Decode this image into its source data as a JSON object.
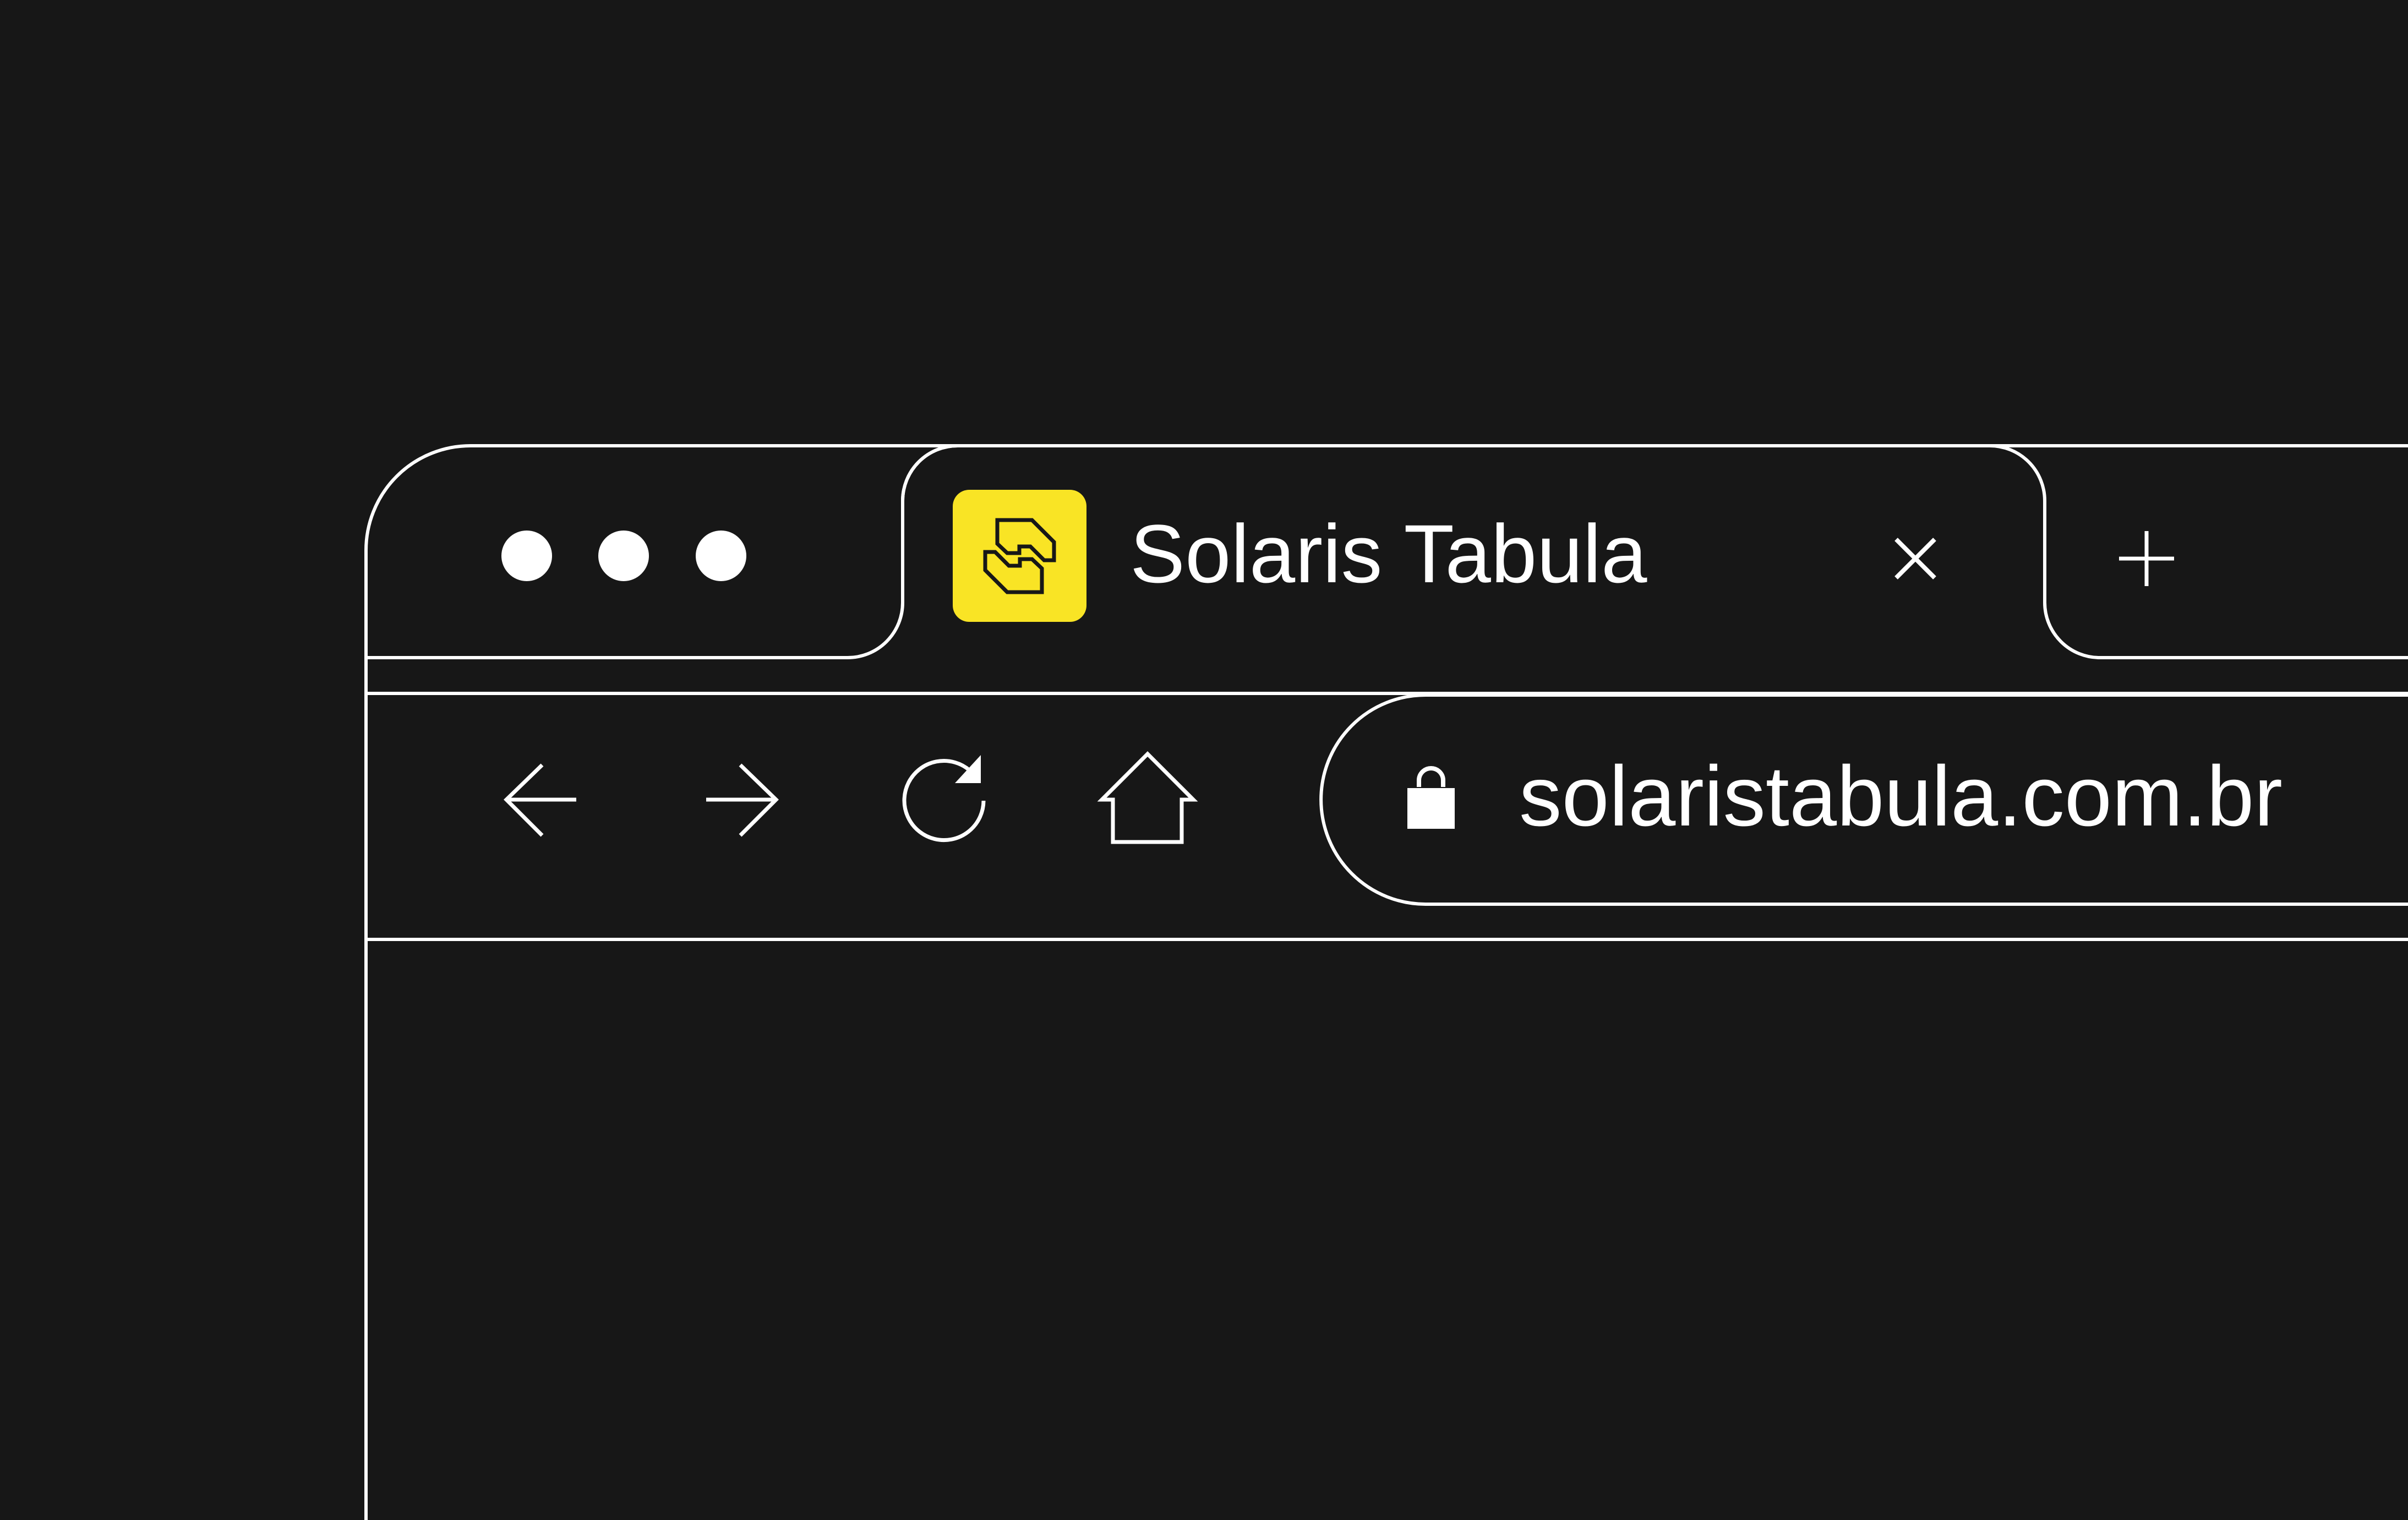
{
  "browser": {
    "window_controls": [
      "window-dot-1",
      "window-dot-2",
      "window-dot-3"
    ],
    "active_tab": {
      "title": "Solaris Tabula",
      "favicon": "solaris-tabula-logo",
      "close_icon": "close-icon"
    },
    "new_tab_icon": "plus-icon",
    "toolbar": {
      "back_icon": "arrow-left-icon",
      "forward_icon": "arrow-right-icon",
      "reload_icon": "reload-icon",
      "home_icon": "home-icon"
    },
    "address_bar": {
      "lock_icon": "lock-icon",
      "url": "solaristabula.com.br"
    }
  },
  "colors": {
    "background": "#171717",
    "outline": "#ffffff",
    "brand_yellow": "#f9e425",
    "brand_ink": "#171717"
  }
}
